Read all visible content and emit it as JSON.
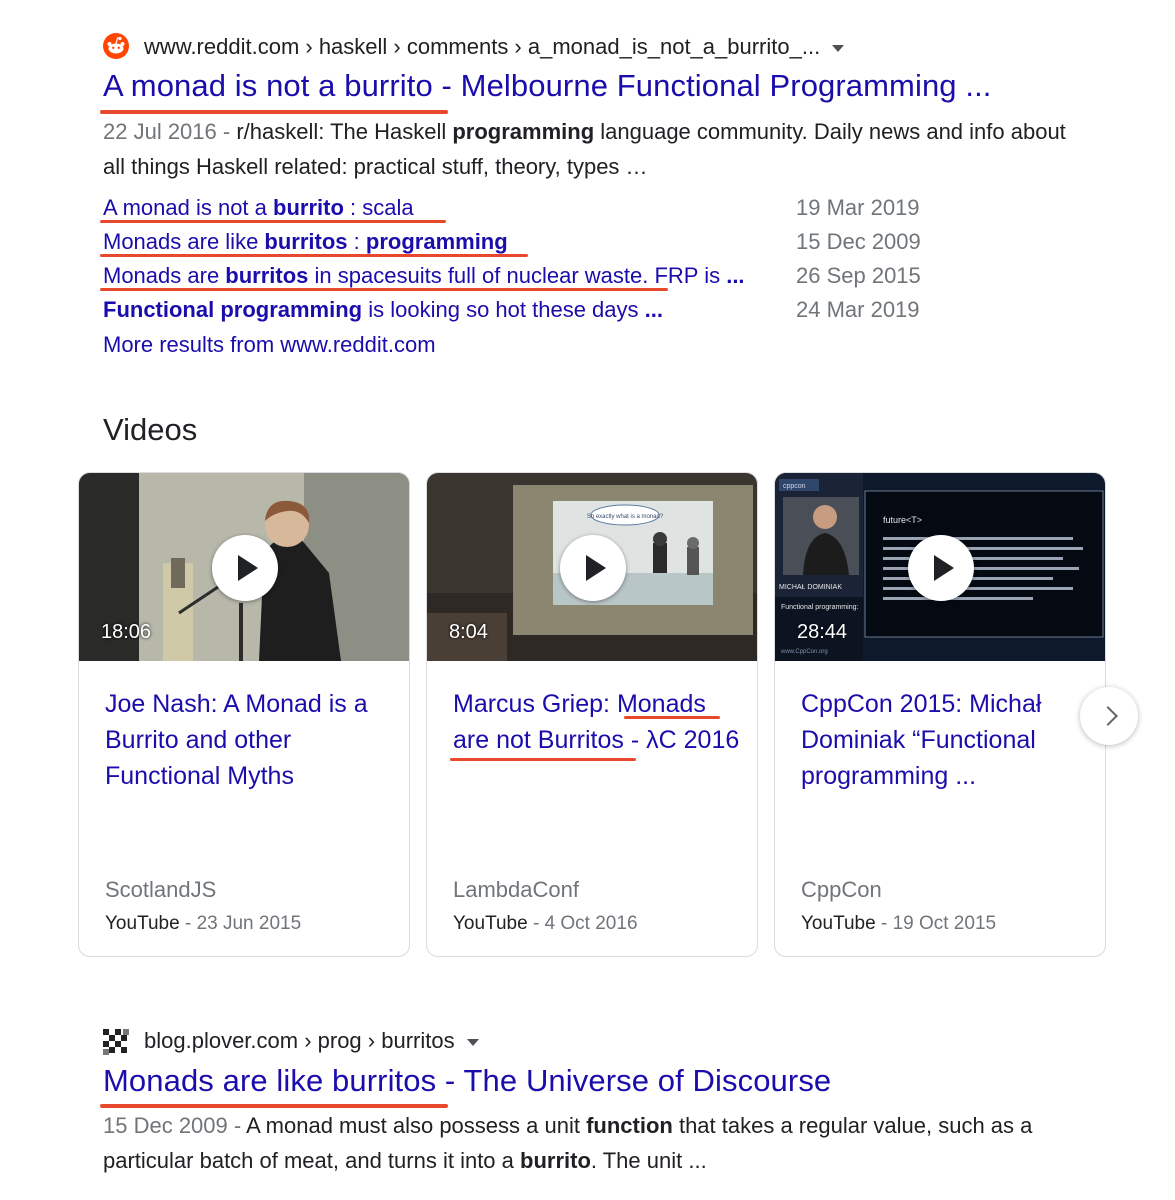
{
  "result1": {
    "favicon": "reddit-alien-icon",
    "breadcrumb": "www.reddit.com › haskell › comments › a_monad_is_not_a_burrito_...",
    "title": {
      "part1": "A monad is not a burrito",
      "part2": " - Melbourne Functional Programming ..."
    },
    "snippet": {
      "date": "22 Jul 2016",
      "sep": " - ",
      "t1": "r/haskell: The Haskell ",
      "b1": "programming",
      "t2": " language community. Daily news and info about all things Haskell related: practical stuff, theory, types …"
    },
    "sublinks": [
      {
        "t1": "A monad is not a ",
        "b1": "burrito",
        "t2": " : scala",
        "date": "19 Mar 2019"
      },
      {
        "t1": "Monads are like ",
        "b1": "burritos",
        "t2": " : ",
        "b2": "programming",
        "date": "15 Dec 2009"
      },
      {
        "t1": "Monads are ",
        "b1": "burritos",
        "t2": " in spacesuits full of nuclear waste. FRP is ",
        "b2": "...",
        "date": "26 Sep 2015"
      },
      {
        "b1": "Functional programming",
        "t2": " is looking so hot these days ",
        "b2": "...",
        "date": "24 Mar 2019"
      }
    ],
    "more": "More results from www.reddit.com"
  },
  "videos": {
    "heading": "Videos",
    "items": [
      {
        "duration": "18:06",
        "title": "Joe Nash: A Monad is a Burrito and other Functional Myths",
        "channel": "ScotlandJS",
        "source": "YouTube",
        "sep": " - ",
        "date": "23 Jun 2015"
      },
      {
        "duration": "8:04",
        "title_a": "Marcus Griep: ",
        "title_b": "Monads",
        "title_c": "are not Burritos",
        "title_d": " - λC 2016",
        "channel": "LambdaConf",
        "source": "YouTube",
        "sep": " - ",
        "date": "4 Oct 2016"
      },
      {
        "duration": "28:44",
        "title": "CppCon 2015: Michał Dominiak “Functional programming ...",
        "channel": "CppCon",
        "source": "YouTube",
        "sep": " - ",
        "date": "19 Oct 2015"
      }
    ],
    "slide_text": "So exactly what is a monad?",
    "cppcon_logo": "cppcon",
    "cppcon_slide_title": "future<T>",
    "cppcon_name": "MICHAŁ DOMINIAK",
    "cppcon_lower": "Functional programming:",
    "cppcon_url": "www.CppCon.org"
  },
  "result2": {
    "favicon": "checkerboard-favicon-icon",
    "breadcrumb": "blog.plover.com › prog › burritos",
    "title": {
      "part1": "Monads are like burritos",
      "part2": " - The Universe of Discourse"
    },
    "snippet": {
      "date": "15 Dec 2009",
      "sep": " - ",
      "t1": "A monad must also possess a unit ",
      "b1": "function",
      "t2": " that takes a regular value, such as a particular batch of meat, and turns it into a ",
      "b2": "burrito",
      "t3": ". The unit ..."
    }
  },
  "colors": {
    "link": "#1a0dab",
    "annotation": "#e8492c",
    "reddit": "#ff4500"
  }
}
